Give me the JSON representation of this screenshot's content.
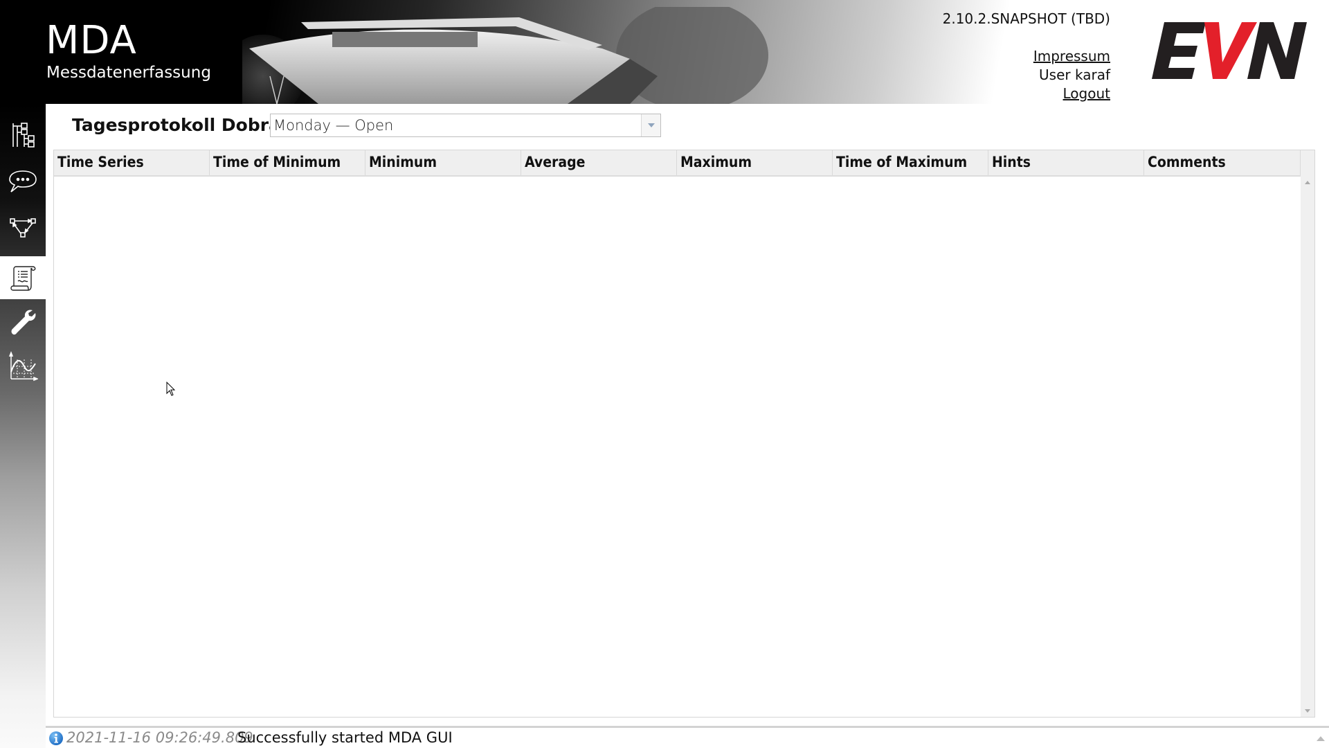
{
  "app": {
    "title": "MDA",
    "subtitle": "Messdatenerfassung",
    "version": "2.10.2.SNAPSHOT (TBD)",
    "logo_text": "EVN",
    "brand_colors": {
      "logo_dark": "#231f20",
      "logo_red": "#e3202a"
    }
  },
  "header_links": {
    "impressum": "Impressum",
    "user": "User karaf",
    "logout": "Logout"
  },
  "sidebar": {
    "items": [
      {
        "name": "hierarchy",
        "icon": "hierarchy-tree-icon",
        "active": false
      },
      {
        "name": "messages",
        "icon": "speech-bubble-icon",
        "active": false
      },
      {
        "name": "workflow",
        "icon": "graph-network-icon",
        "active": false
      },
      {
        "name": "daily-protocol",
        "icon": "scroll-document-icon",
        "active": true
      },
      {
        "name": "settings",
        "icon": "wrench-icon",
        "active": false
      },
      {
        "name": "charts",
        "icon": "line-chart-icon",
        "active": false
      }
    ]
  },
  "main": {
    "title": "Tagesprotokoll Dobra",
    "selector": {
      "selected": "Monday — Open"
    },
    "table": {
      "columns": [
        "Time Series",
        "Time of Minimum",
        "Minimum",
        "Average",
        "Maximum",
        "Time of Maximum",
        "Hints",
        "Comments"
      ],
      "rows": []
    }
  },
  "status": {
    "icon": "info-icon",
    "timestamp": "2021-11-16 09:26:49.809",
    "message": "Successfully started MDA GUI",
    "icon_color": "#1e7fd0"
  }
}
